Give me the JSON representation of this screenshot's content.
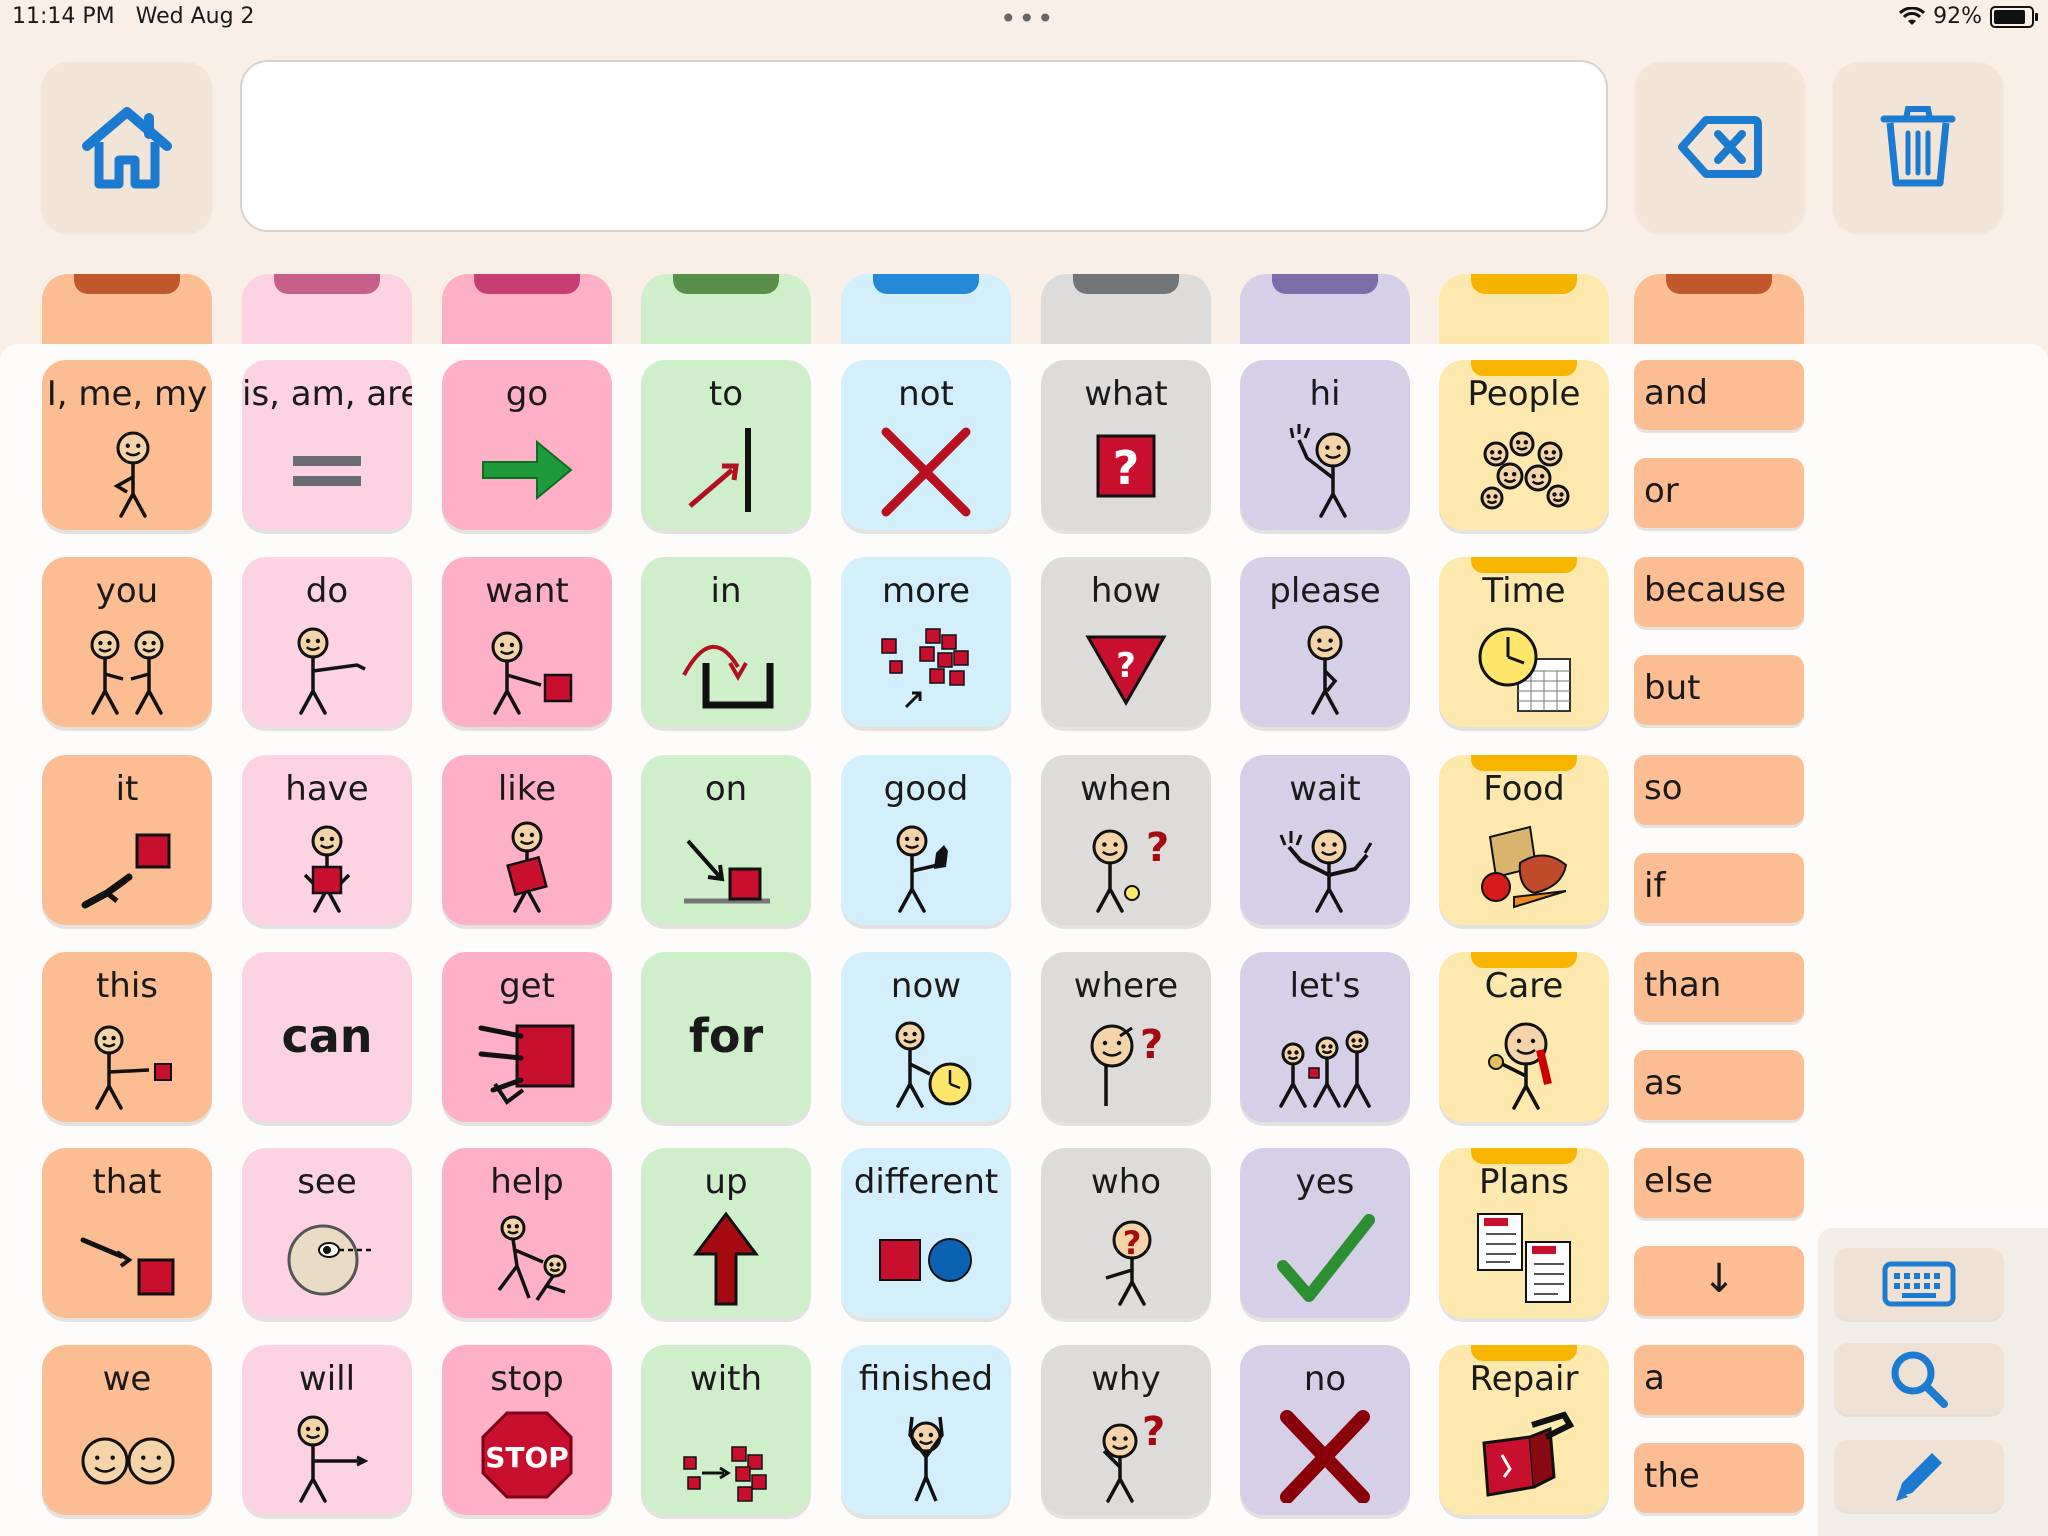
{
  "status": {
    "time": "11:14 PM",
    "date": "Wed Aug 2",
    "dots": "•••",
    "battery": "92%",
    "battery_level": 0.92
  },
  "toolbar": {
    "home_icon": "home-icon",
    "backspace_icon": "backspace-icon",
    "trash_icon": "trash-icon",
    "message_text": ""
  },
  "colors": {
    "orange": "#fdbd92",
    "pink": "#fdd3e4",
    "hotpink": "#feb0c6",
    "green": "#cfefcb",
    "blue": "#d3effb",
    "gray": "#dddcdb",
    "purple": "#d6cfe8",
    "yellow": "#fde9ae",
    "accent": "#1a7bd0"
  },
  "folders": [
    {
      "color": "#fdbd92",
      "tab": "#c0582b"
    },
    {
      "color": "#fdd3e4",
      "tab": "#c5608a"
    },
    {
      "color": "#feb0c6",
      "tab": "#c93d75"
    },
    {
      "color": "#cfefcb",
      "tab": "#5a8f4b"
    },
    {
      "color": "#d3effb",
      "tab": "#2389d7"
    },
    {
      "color": "#dddcdb",
      "tab": "#737478"
    },
    {
      "color": "#d6cfe8",
      "tab": "#7a6da8"
    },
    {
      "color": "#fde9ae",
      "tab": "#f6b400"
    },
    {
      "color": "#fdbd92",
      "tab": "#c0582b"
    }
  ],
  "grid": {
    "columns": [
      {
        "color": "#fdbd92",
        "tiles": [
          {
            "label": "I, me, my",
            "icon": "person-pointing-self-icon"
          },
          {
            "label": "you",
            "icon": "two-people-pointing-icon"
          },
          {
            "label": "it",
            "icon": "hand-pointing-square-icon"
          },
          {
            "label": "this",
            "icon": "person-pointing-near-icon"
          },
          {
            "label": "that",
            "icon": "hand-pointing-far-icon"
          },
          {
            "label": "we",
            "icon": "two-faces-icon"
          }
        ]
      },
      {
        "color": "#fdd3e4",
        "tiles": [
          {
            "label": "is, am, are",
            "icon": "equals-icon"
          },
          {
            "label": "do",
            "icon": "person-reaching-icon"
          },
          {
            "label": "have",
            "icon": "person-holding-box-icon"
          },
          {
            "label": "can",
            "icon": "",
            "big": true
          },
          {
            "label": "see",
            "icon": "eye-face-icon"
          },
          {
            "label": "will",
            "icon": "person-pointing-forward-icon"
          }
        ]
      },
      {
        "color": "#feb0c6",
        "tiles": [
          {
            "label": "go",
            "icon": "green-arrow-right-icon"
          },
          {
            "label": "want",
            "icon": "person-reaching-box-icon"
          },
          {
            "label": "like",
            "icon": "person-hugging-box-icon"
          },
          {
            "label": "get",
            "icon": "hands-grabbing-box-icon"
          },
          {
            "label": "help",
            "icon": "people-helping-icon"
          },
          {
            "label": "stop",
            "icon": "stop-sign-icon"
          }
        ]
      },
      {
        "color": "#cfefcb",
        "tiles": [
          {
            "label": "to",
            "icon": "arrow-to-line-icon"
          },
          {
            "label": "in",
            "icon": "arrow-into-box-icon"
          },
          {
            "label": "on",
            "icon": "arrow-onto-surface-icon"
          },
          {
            "label": "for",
            "icon": "",
            "big": true
          },
          {
            "label": "up",
            "icon": "arrow-up-icon"
          },
          {
            "label": "with",
            "icon": "cubes-together-icon"
          }
        ]
      },
      {
        "color": "#d3effb",
        "tiles": [
          {
            "label": "not",
            "icon": "red-x-icon"
          },
          {
            "label": "more",
            "icon": "more-cubes-icon"
          },
          {
            "label": "good",
            "icon": "thumbs-up-person-icon"
          },
          {
            "label": "now",
            "icon": "person-clock-icon"
          },
          {
            "label": "different",
            "icon": "square-circle-icon"
          },
          {
            "label": "finished",
            "icon": "person-arms-up-icon"
          }
        ]
      },
      {
        "color": "#dddcdb",
        "tiles": [
          {
            "label": "what",
            "icon": "question-box-icon"
          },
          {
            "label": "how",
            "icon": "question-triangle-icon"
          },
          {
            "label": "when",
            "icon": "person-question-clock-icon"
          },
          {
            "label": "where",
            "icon": "person-looking-question-icon"
          },
          {
            "label": "who",
            "icon": "person-question-head-icon"
          },
          {
            "label": "why",
            "icon": "person-thinking-question-icon"
          }
        ]
      },
      {
        "color": "#d6cfe8",
        "tiles": [
          {
            "label": "hi",
            "icon": "person-waving-icon"
          },
          {
            "label": "please",
            "icon": "person-hand-chest-icon"
          },
          {
            "label": "wait",
            "icon": "person-two-hands-up-icon"
          },
          {
            "label": "let's",
            "icon": "three-people-icon"
          },
          {
            "label": "yes",
            "icon": "green-check-icon"
          },
          {
            "label": "no",
            "icon": "dark-red-x-icon"
          }
        ]
      },
      {
        "color": "#fde9ae",
        "tiles": [
          {
            "label": "People",
            "icon": "crowd-faces-icon",
            "folder": true
          },
          {
            "label": "Time",
            "icon": "clock-calendar-icon",
            "folder": true
          },
          {
            "label": "Food",
            "icon": "food-group-icon",
            "folder": true
          },
          {
            "label": "Care",
            "icon": "person-brushing-teeth-icon",
            "folder": true
          },
          {
            "label": "Plans",
            "icon": "plan-documents-icon",
            "folder": true
          },
          {
            "label": "Repair",
            "icon": "broken-box-tool-icon",
            "folder": true
          }
        ]
      }
    ]
  },
  "conjunctions": [
    "and",
    "or",
    "because",
    "but",
    "so",
    "if",
    "than",
    "as",
    "else",
    "↓",
    "a",
    "the"
  ],
  "side_buttons": {
    "keyboard_icon": "keyboard-icon",
    "search_icon": "search-icon",
    "pencil_icon": "pencil-icon"
  }
}
